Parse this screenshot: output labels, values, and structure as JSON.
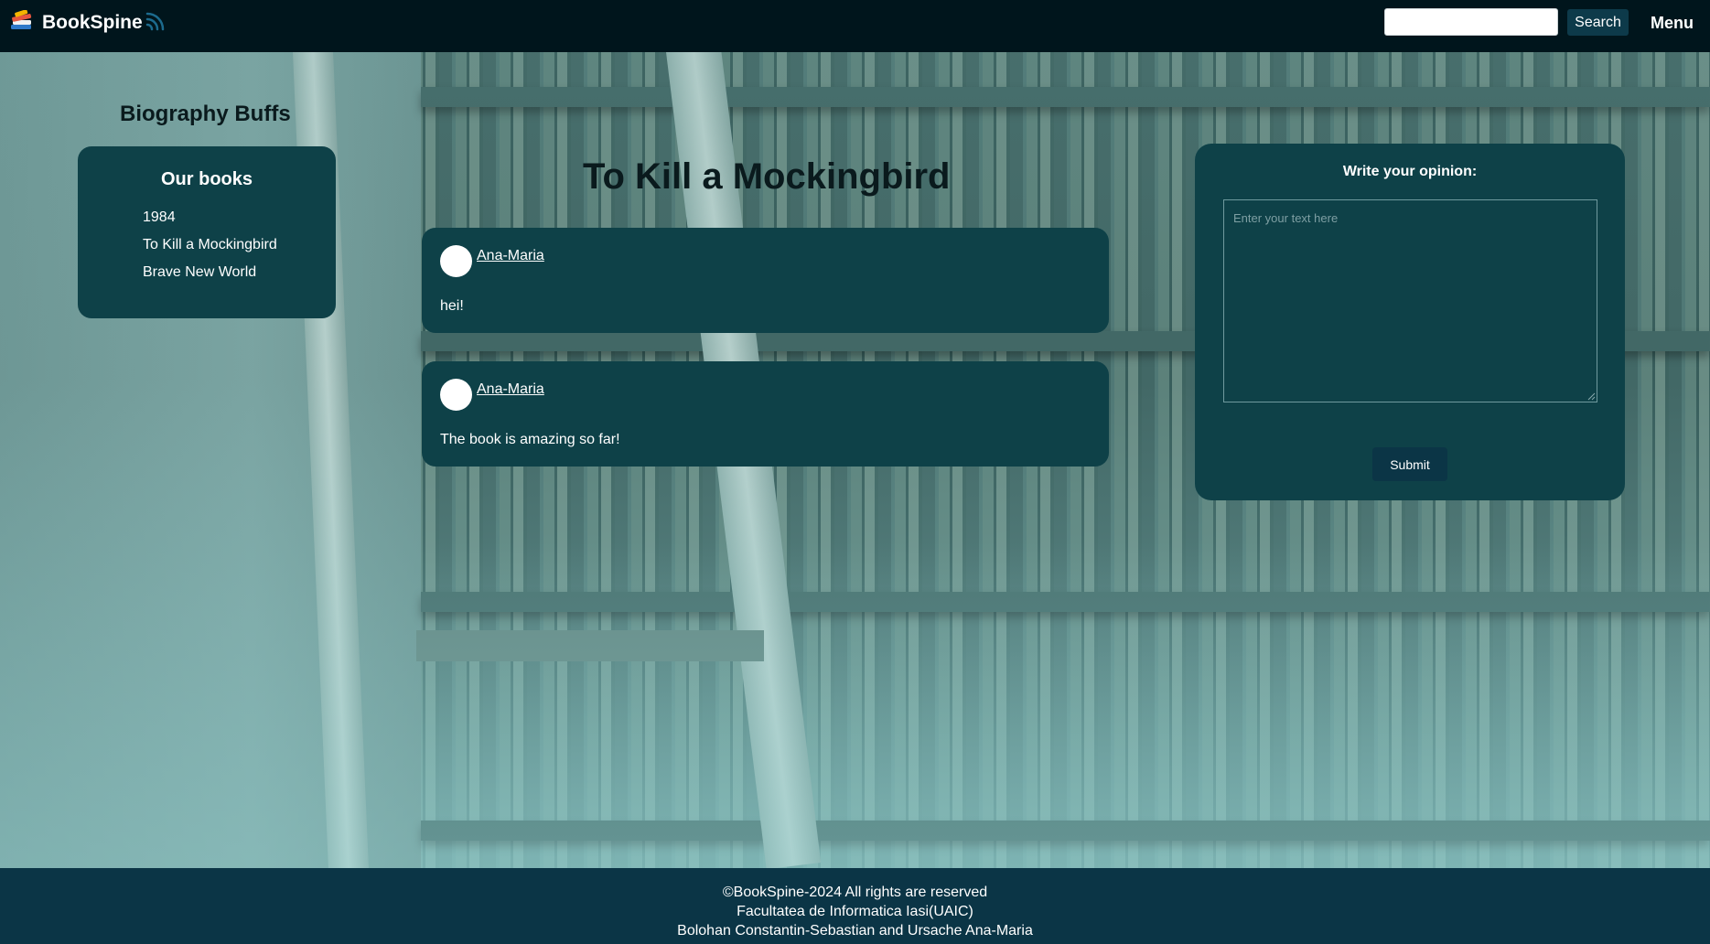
{
  "header": {
    "brand": "BookSpine",
    "search_placeholder": "",
    "search_button": "Search",
    "menu_label": "Menu",
    "icons": [
      "books-logo-icon",
      "rss-icon"
    ]
  },
  "sidebar": {
    "club_name": "Biography Buffs",
    "heading": "Our books",
    "books": [
      "1984",
      "To Kill a Mockingbird",
      "Brave New World"
    ]
  },
  "main": {
    "book_title": "To Kill a Mockingbird",
    "comments": [
      {
        "author": "Ana-Maria",
        "text": "hei!"
      },
      {
        "author": "Ana-Maria",
        "text": "The book is amazing so far!"
      }
    ]
  },
  "opinion": {
    "heading": "Write your opinion:",
    "placeholder": "Enter your text here",
    "submit_label": "Submit"
  },
  "footer": {
    "lines": [
      "©BookSpine-2024 All rights are reserved",
      "Facultatea de Informatica Iasi(UAIC)",
      "Bolohan Constantin-Sebastian and Ursache Ana-Maria"
    ]
  },
  "colors": {
    "topbar": "#00151c",
    "panel": "#0e4148",
    "footer": "#0b3546",
    "button": "#0d3a4a"
  }
}
